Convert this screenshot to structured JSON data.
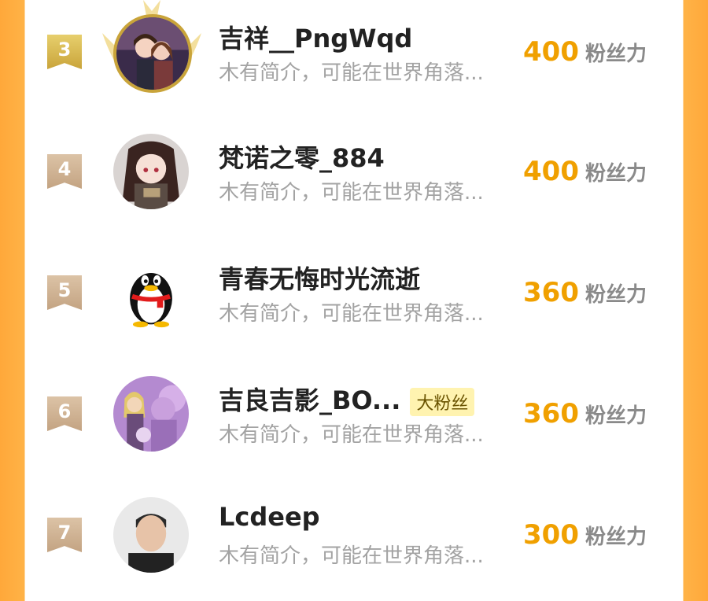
{
  "rows": [
    {
      "rank": "3",
      "name": "吉祥__PngWqd",
      "bio": "木有简介，可能在世界角落...",
      "score": "400",
      "unit": "粉丝力",
      "badge": "",
      "avatar_icon": "anime-couple-avatar"
    },
    {
      "rank": "4",
      "name": "梵诺之零_884",
      "bio": "木有简介，可能在世界角落...",
      "score": "400",
      "unit": "粉丝力",
      "badge": "",
      "avatar_icon": "anime-girl-avatar"
    },
    {
      "rank": "5",
      "name": "青春无悔时光流逝",
      "bio": "木有简介，可能在世界角落...",
      "score": "360",
      "unit": "粉丝力",
      "badge": "",
      "avatar_icon": "qq-penguin-avatar"
    },
    {
      "rank": "6",
      "name": "吉良吉影_BO...",
      "bio": "木有简介，可能在世界角落...",
      "score": "360",
      "unit": "粉丝力",
      "badge": "大粉丝",
      "avatar_icon": "jojo-character-avatar"
    },
    {
      "rank": "7",
      "name": "Lcdeep",
      "bio": "木有简介，可能在世界角落...",
      "score": "300",
      "unit": "粉丝力",
      "badge": "",
      "avatar_icon": "man-portrait-avatar"
    }
  ],
  "colors": {
    "score": "#f0a000",
    "gold_rank": "#d4b34a",
    "tan_rank": "#cfb090",
    "side": "#ffb347"
  }
}
